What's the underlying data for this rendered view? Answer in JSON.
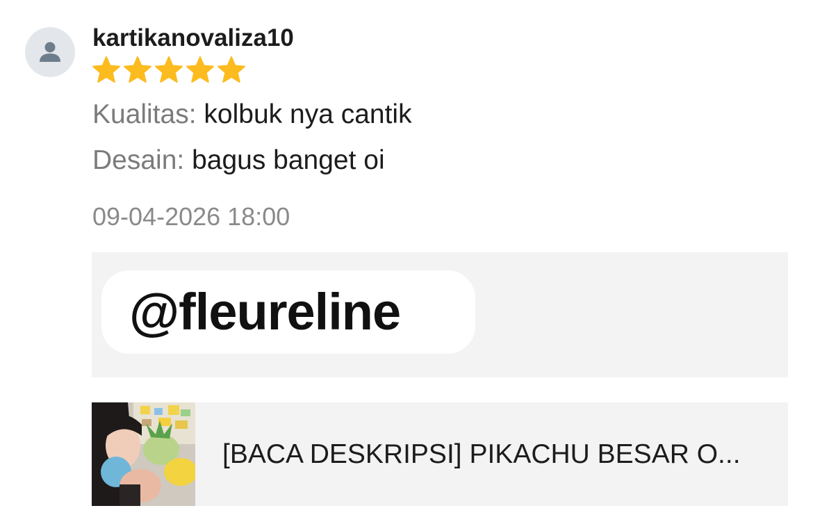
{
  "review": {
    "username": "kartikanovaliza10",
    "rating": 5,
    "rating_max": 5,
    "star_color": "#fcbb1f",
    "quality_label": "Kualitas:",
    "quality_value": " kolbuk nya cantik",
    "design_label": "Desain:",
    "design_value": " bagus banget oi",
    "timestamp": "09-04-2026 18:00"
  },
  "media": {
    "handle": "@fleureline"
  },
  "product": {
    "title": "[BACA DESKRIPSI] PIKACHU BESAR O..."
  },
  "icons": {
    "avatar": "user-icon",
    "star": "star-icon"
  }
}
